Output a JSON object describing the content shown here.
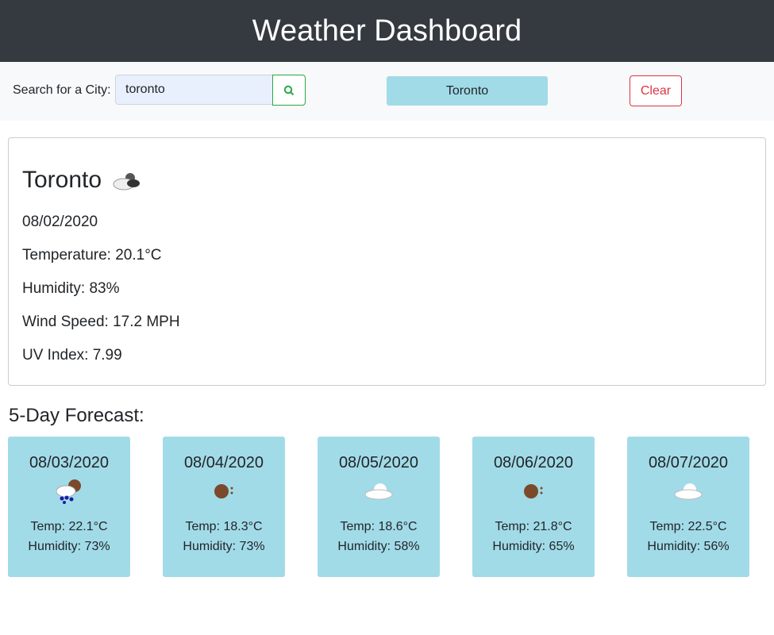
{
  "header": {
    "title": "Weather Dashboard"
  },
  "search": {
    "label": "Search for a City:",
    "value": "toronto",
    "button_icon": "search-icon",
    "history": [
      "Toronto"
    ],
    "clear_label": "Clear"
  },
  "current": {
    "city": "Toronto",
    "icon": "cloudy-icon",
    "date": "08/02/2020",
    "temperature": "Temperature: 20.1°C",
    "humidity": "Humidity: 83%",
    "wind": "Wind Speed: 17.2 MPH",
    "uv": "UV Index: 7.99"
  },
  "forecast": {
    "title": "5-Day Forecast:",
    "days": [
      {
        "date": "08/03/2020",
        "icon": "rain-icon",
        "temp": "Temp: 22.1°C",
        "humidity": "Humidity: 73%"
      },
      {
        "date": "08/04/2020",
        "icon": "clear-icon",
        "temp": "Temp: 18.3°C",
        "humidity": "Humidity: 73%"
      },
      {
        "date": "08/05/2020",
        "icon": "cloud-icon",
        "temp": "Temp: 18.6°C",
        "humidity": "Humidity: 58%"
      },
      {
        "date": "08/06/2020",
        "icon": "clear-icon",
        "temp": "Temp: 21.8°C",
        "humidity": "Humidity: 65%"
      },
      {
        "date": "08/07/2020",
        "icon": "cloud-icon",
        "temp": "Temp: 22.5°C",
        "humidity": "Humidity: 56%"
      }
    ]
  },
  "colors": {
    "header": "#343a40",
    "accent": "#a2dbe8",
    "search": "#28a745",
    "clear": "#dc3545"
  }
}
